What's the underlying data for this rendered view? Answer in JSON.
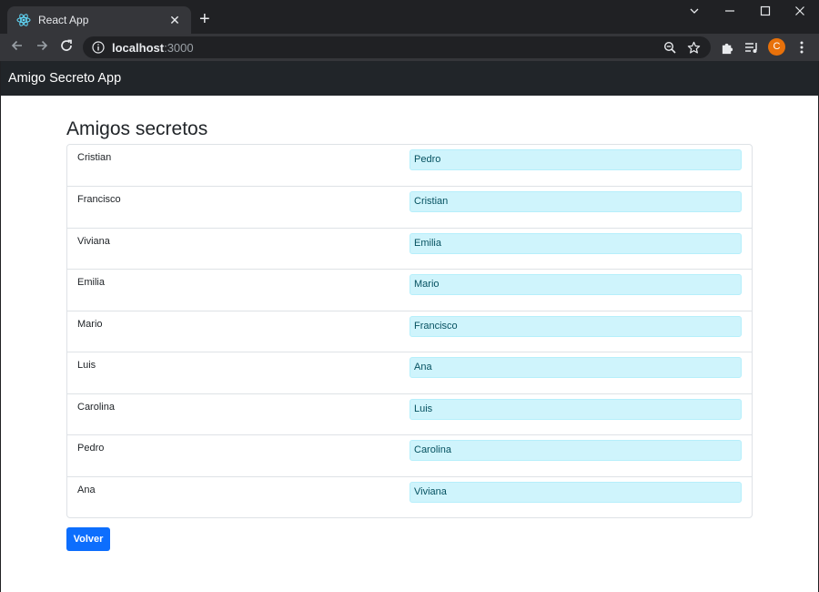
{
  "browser": {
    "tab_title": "React App",
    "tab_close": "✕",
    "new_tab": "+",
    "url_host": "localhost",
    "url_rest": ":3000",
    "profile_initial": "C"
  },
  "app": {
    "brand": "Amigo Secreto App",
    "title": "Amigos secretos",
    "back_label": "Volver"
  },
  "pairs": [
    {
      "giver": "Cristian",
      "receiver": "Pedro"
    },
    {
      "giver": "Francisco",
      "receiver": "Cristian"
    },
    {
      "giver": "Viviana",
      "receiver": "Emilia"
    },
    {
      "giver": "Emilia",
      "receiver": "Mario"
    },
    {
      "giver": "Mario",
      "receiver": "Francisco"
    },
    {
      "giver": "Luis",
      "receiver": "Ana"
    },
    {
      "giver": "Carolina",
      "receiver": "Luis"
    },
    {
      "giver": "Pedro",
      "receiver": "Carolina"
    },
    {
      "giver": "Ana",
      "receiver": "Viviana"
    }
  ],
  "icons": {
    "favicon": "react-icon",
    "back": "arrow-left-icon",
    "forward": "arrow-right-icon",
    "reload": "reload-icon",
    "info": "info-icon",
    "zoom": "zoom-out-icon",
    "bookmark": "star-icon",
    "extensions": "puzzle-icon",
    "media": "media-queue-icon",
    "menu": "kebab-menu-icon"
  },
  "colors": {
    "chrome_dark": "#202124",
    "chrome_toolbar": "#35363a",
    "navbar": "#212529",
    "match_bg": "#cff4fc",
    "primary": "#0d6efd",
    "profile": "#e8710a"
  }
}
